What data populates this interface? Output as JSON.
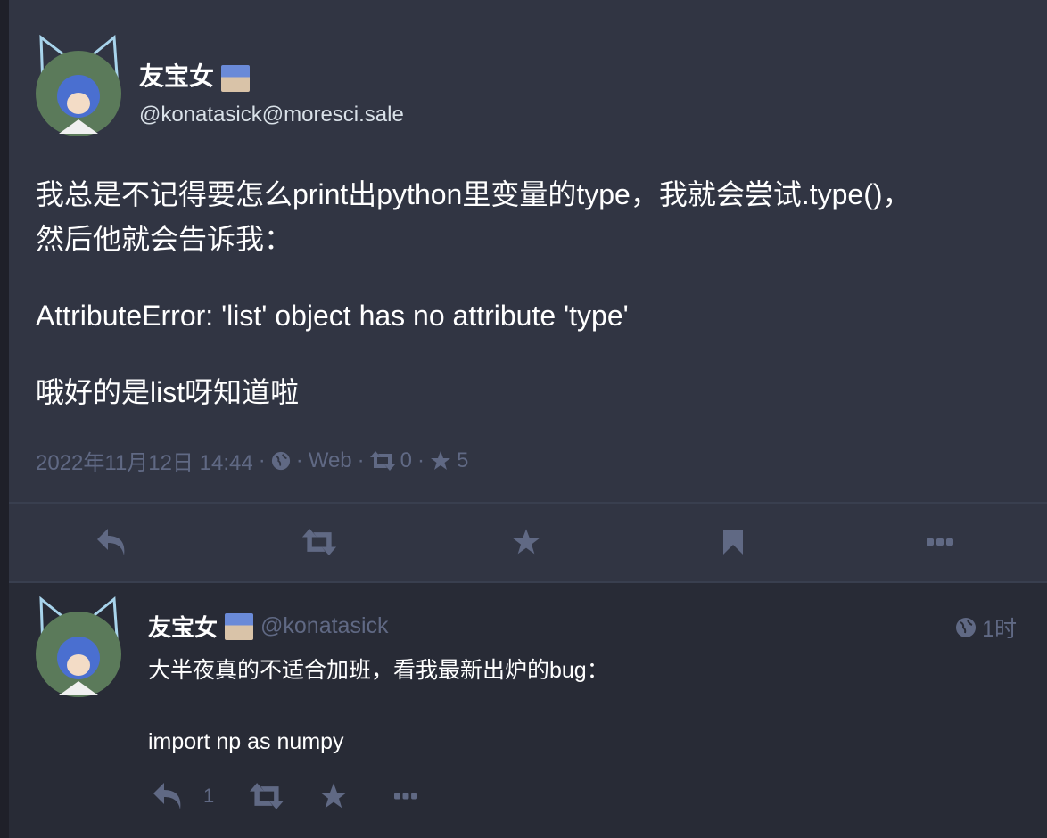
{
  "status": {
    "display_name": "友宝女",
    "account": "@konatasick@moresci.sale",
    "content": [
      "我总是不记得要怎么print出python里变量的type，我就会尝试.type()，然后他就会告诉我：",
      "AttributeError: 'list' object has no attribute 'type'",
      "哦好的是list呀知道啦"
    ],
    "timestamp": "2022年11月12日 14:44",
    "visibility_icon": "globe-icon",
    "application": "Web",
    "reblogs": "0",
    "favourites": "5",
    "separator": "·"
  },
  "action_bar": [
    "reply-icon",
    "boost-icon",
    "star-icon",
    "bookmark-icon",
    "ellipsis-icon"
  ],
  "reply": {
    "display_name": "友宝女",
    "account": "@konatasick",
    "relative_time": "1时",
    "content": [
      "大半夜真的不适合加班，看我最新出炉的bug：",
      "import np as numpy"
    ],
    "reply_count": "1"
  },
  "colors": {
    "background": "#313543",
    "reply_background": "#282b36",
    "muted": "#606984",
    "avatar_ears": "#a8d4ec"
  }
}
